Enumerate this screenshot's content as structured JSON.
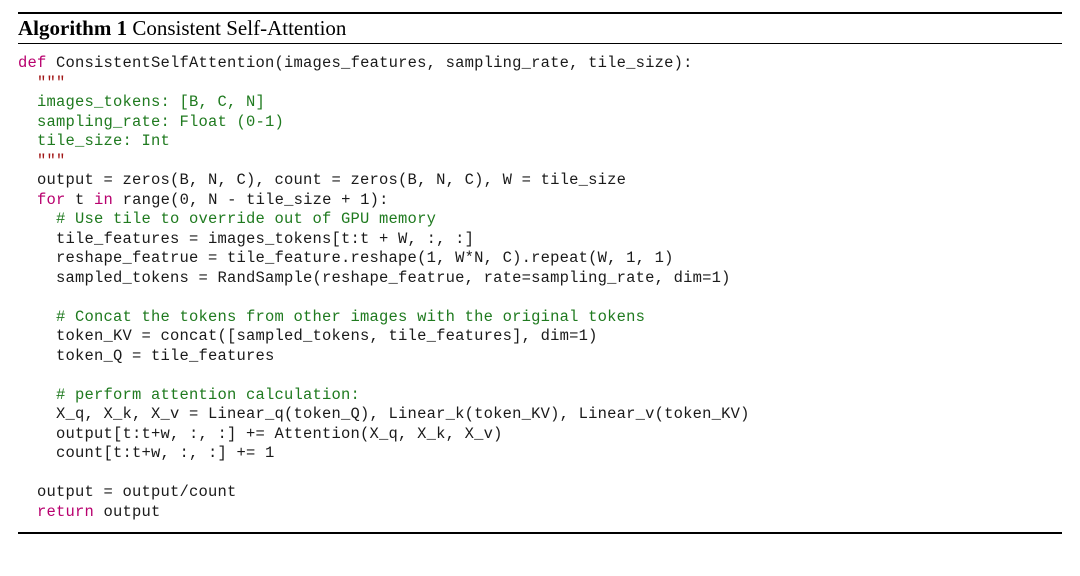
{
  "algorithm": {
    "label_number": "Algorithm 1",
    "label_caption": " Consistent Self-Attention",
    "lines": [
      {
        "cls": "",
        "segs": [
          {
            "t": "kw-def",
            "v": "def"
          },
          {
            "t": "",
            "v": " ConsistentSelfAttention(images_features, sampling_rate, tile_size):"
          }
        ]
      },
      {
        "cls": "",
        "segs": [
          {
            "t": "kw-str",
            "v": "  \"\"\""
          }
        ]
      },
      {
        "cls": "",
        "segs": [
          {
            "t": "docstr",
            "v": "  images_tokens: [B, C, N]"
          }
        ]
      },
      {
        "cls": "",
        "segs": [
          {
            "t": "docstr",
            "v": "  sampling_rate: Float (0-1)"
          }
        ]
      },
      {
        "cls": "",
        "segs": [
          {
            "t": "docstr",
            "v": "  tile_size: Int"
          }
        ]
      },
      {
        "cls": "",
        "segs": [
          {
            "t": "kw-str",
            "v": "  \"\"\""
          }
        ]
      },
      {
        "cls": "",
        "segs": [
          {
            "t": "",
            "v": "  output = zeros(B, N, C), count = zeros(B, N, C), W = tile_size"
          }
        ]
      },
      {
        "cls": "",
        "segs": [
          {
            "t": "",
            "v": "  "
          },
          {
            "t": "kw-def",
            "v": "for"
          },
          {
            "t": "",
            "v": " t "
          },
          {
            "t": "kw-def",
            "v": "in"
          },
          {
            "t": "",
            "v": " range(0, N - tile_size + 1):"
          }
        ]
      },
      {
        "cls": "",
        "segs": [
          {
            "t": "comment",
            "v": "    # Use tile to override out of GPU memory"
          }
        ]
      },
      {
        "cls": "",
        "segs": [
          {
            "t": "",
            "v": "    tile_features = images_tokens[t:t + W, :, :]"
          }
        ]
      },
      {
        "cls": "",
        "segs": [
          {
            "t": "",
            "v": "    reshape_featrue = tile_feature.reshape(1, W*N, C).repeat(W, 1, 1)"
          }
        ]
      },
      {
        "cls": "",
        "segs": [
          {
            "t": "",
            "v": "    sampled_tokens = RandSample(reshape_featrue, rate=sampling_rate, dim=1)"
          }
        ]
      },
      {
        "cls": "",
        "segs": [
          {
            "t": "",
            "v": ""
          }
        ]
      },
      {
        "cls": "",
        "segs": [
          {
            "t": "comment",
            "v": "    # Concat the tokens from other images with the original tokens"
          }
        ]
      },
      {
        "cls": "",
        "segs": [
          {
            "t": "",
            "v": "    token_KV = concat([sampled_tokens, tile_features], dim=1)"
          }
        ]
      },
      {
        "cls": "",
        "segs": [
          {
            "t": "",
            "v": "    token_Q = tile_features"
          }
        ]
      },
      {
        "cls": "",
        "segs": [
          {
            "t": "",
            "v": ""
          }
        ]
      },
      {
        "cls": "",
        "segs": [
          {
            "t": "comment",
            "v": "    # perform attention calculation:"
          }
        ]
      },
      {
        "cls": "",
        "segs": [
          {
            "t": "",
            "v": "    X_q, X_k, X_v = Linear_q(token_Q), Linear_k(token_KV), Linear_v(token_KV)"
          }
        ]
      },
      {
        "cls": "",
        "segs": [
          {
            "t": "",
            "v": "    output[t:t+w, :, :] += Attention(X_q, X_k, X_v)"
          }
        ]
      },
      {
        "cls": "",
        "segs": [
          {
            "t": "",
            "v": "    count[t:t+w, :, :] += 1"
          }
        ]
      },
      {
        "cls": "",
        "segs": [
          {
            "t": "",
            "v": ""
          }
        ]
      },
      {
        "cls": "",
        "segs": [
          {
            "t": "",
            "v": "  output = output/count"
          }
        ]
      },
      {
        "cls": "",
        "segs": [
          {
            "t": "",
            "v": "  "
          },
          {
            "t": "kw-def",
            "v": "return"
          },
          {
            "t": "",
            "v": " output"
          }
        ]
      }
    ]
  }
}
